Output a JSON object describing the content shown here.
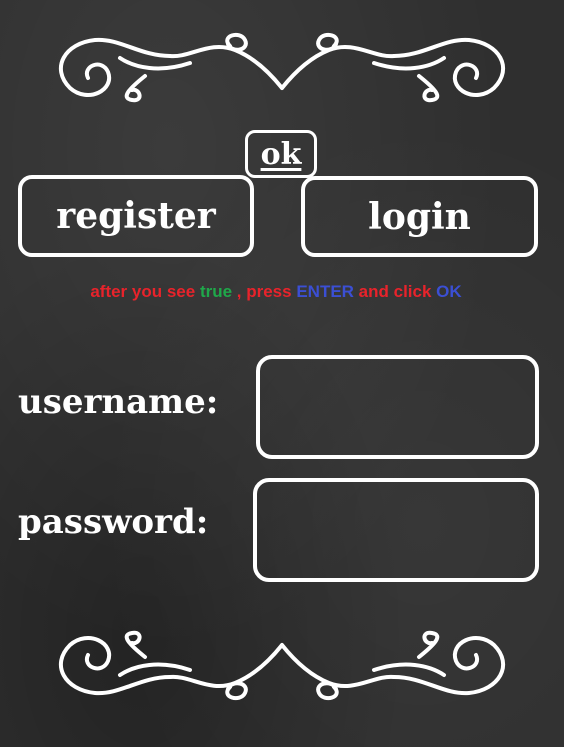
{
  "buttons": {
    "ok_label": "ok",
    "register_label": "register",
    "login_label": "login"
  },
  "hint": {
    "part1": "after you see ",
    "part2": "true",
    "part3": " , press ",
    "part4": "ENTER",
    "part5": " and click ",
    "part6": "OK",
    "colors": {
      "red": "#e8232b",
      "green": "#1fa84a",
      "blue": "#3b4fd4"
    }
  },
  "form": {
    "username_label": "username:",
    "password_label": "password:",
    "username_value": "",
    "password_value": ""
  },
  "decoration": {
    "top_ornament": "swirl-flourish-icon",
    "bottom_ornament": "swirl-flourish-icon"
  }
}
